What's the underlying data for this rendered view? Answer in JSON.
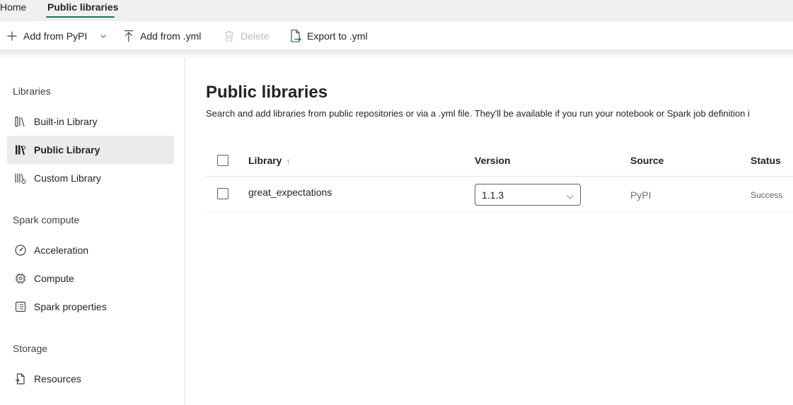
{
  "tabs": {
    "home": "Home",
    "active": "Public libraries"
  },
  "toolbar": {
    "add_pypi": "Add from PyPI",
    "add_yml": "Add from .yml",
    "delete": "Delete",
    "export": "Export to .yml"
  },
  "sidebar": {
    "libraries_title": "Libraries",
    "libraries": [
      {
        "label": "Built-in Library",
        "icon": "books-icon"
      },
      {
        "label": "Public Library",
        "icon": "books-public-icon",
        "selected": true
      },
      {
        "label": "Custom Library",
        "icon": "books-custom-icon"
      }
    ],
    "spark_title": "Spark compute",
    "spark": [
      {
        "label": "Acceleration",
        "icon": "gauge-icon"
      },
      {
        "label": "Compute",
        "icon": "chip-icon"
      },
      {
        "label": "Spark properties",
        "icon": "list-icon"
      }
    ],
    "storage_title": "Storage",
    "storage": [
      {
        "label": "Resources",
        "icon": "document-icon"
      }
    ]
  },
  "main": {
    "title": "Public libraries",
    "description": "Search and add libraries from public repositories or via a .yml file. They'll be available if you run your notebook or Spark job definition i",
    "columns": {
      "library": "Library",
      "version": "Version",
      "source": "Source",
      "status": "Status"
    },
    "rows": [
      {
        "library": "great_expectations",
        "version": "1.1.3",
        "source": "PyPI",
        "status": "Success"
      }
    ]
  },
  "colors": {
    "accent": "#117865",
    "selected_bg": "#ebebeb"
  }
}
